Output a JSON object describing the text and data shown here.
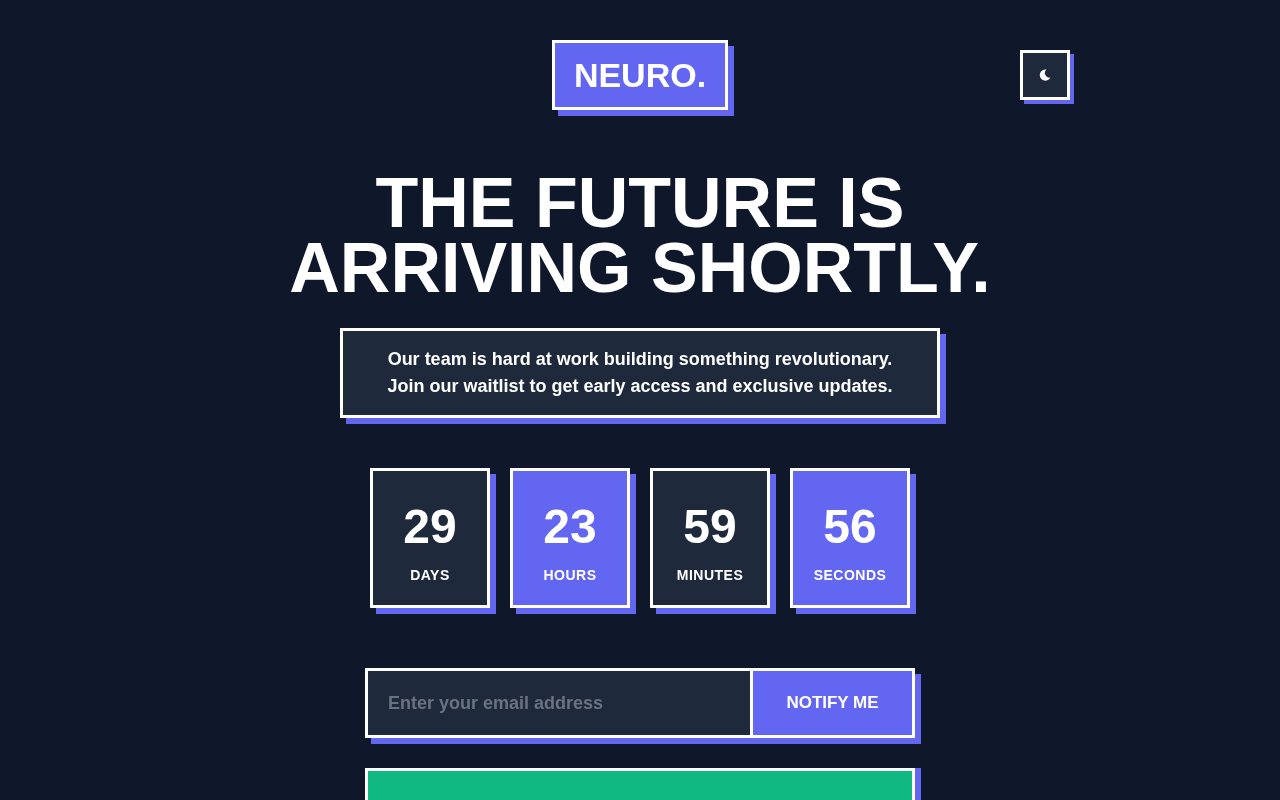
{
  "logo": "NEURO.",
  "headline": "THE FUTURE IS ARRIVING SHORTLY.",
  "description": "Our team is hard at work building something revolutionary.\nJoin our waitlist to get early access and exclusive updates.",
  "countdown": [
    {
      "value": "29",
      "label": "DAYS"
    },
    {
      "value": "23",
      "label": "HOURS"
    },
    {
      "value": "59",
      "label": "MINUTES"
    },
    {
      "value": "56",
      "label": "SECONDS"
    }
  ],
  "signup": {
    "placeholder": "Enter your email address",
    "button": "NOTIFY ME"
  }
}
